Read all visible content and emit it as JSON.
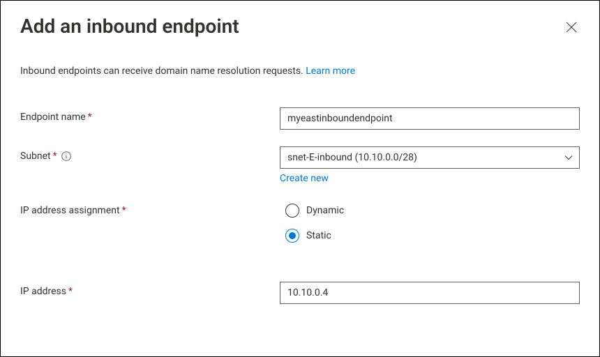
{
  "header": {
    "title": "Add an inbound endpoint"
  },
  "intro": {
    "text": "Inbound endpoints can receive domain name resolution requests. ",
    "learn_more": "Learn more"
  },
  "form": {
    "endpoint_name": {
      "label": "Endpoint name",
      "value": "myeastinboundendpoint"
    },
    "subnet": {
      "label": "Subnet",
      "value": "snet-E-inbound (10.10.0.0/28)",
      "create_new": "Create new"
    },
    "ip_assignment": {
      "label": "IP address assignment",
      "options": {
        "dynamic": "Dynamic",
        "static": "Static"
      },
      "selected": "static"
    },
    "ip_address": {
      "label": "IP address",
      "value": "10.10.0.4"
    }
  }
}
